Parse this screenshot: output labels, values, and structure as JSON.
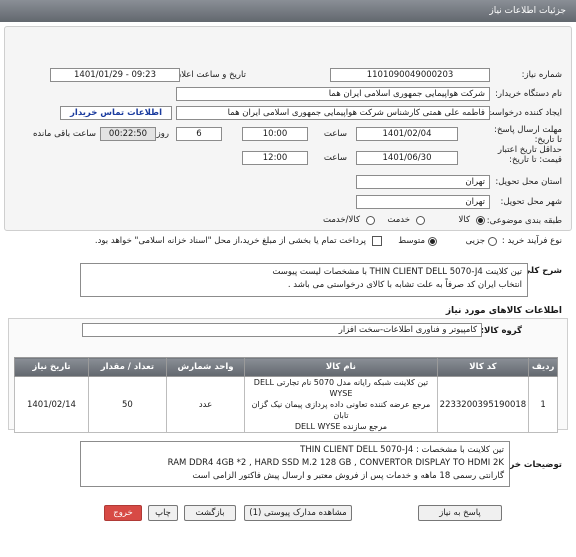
{
  "header": {
    "title": "جزئیات اطلاعات نیاز"
  },
  "form": {
    "need_number_label": "شماره نیاز:",
    "need_number_value": "1101090049000203",
    "announce_label": "تاریخ و ساعت اعلان عمومی:",
    "announce_value": "1401/01/29 - 09:23",
    "buyer_org_label": "نام دستگاه خریدار:",
    "buyer_org_value": "شرکت هواپیمایی جمهوری اسلامی ایران هما",
    "creator_label": "ایجاد کننده درخواست:",
    "creator_value": "فاطمه علی همتی کارشناس شرکت هواپیمایی جمهوری اسلامی ایران هما",
    "contact_button": "اطلاعات تماس خریدار",
    "deadline_label": "مهلت ارسال پاسخ: تا تاریخ:",
    "deadline_date": "1401/02/04",
    "time_label": "ساعت",
    "deadline_time": "10:00",
    "days_count": "6",
    "days_label": "روز و",
    "remaining_time": "00:22:50",
    "remaining_label": "ساعت باقی مانده",
    "validity_label": "حداقل تاریخ اعتبار قیمت: تا تاریخ:",
    "validity_date": "1401/06/30",
    "validity_time_label": "ساعت",
    "validity_time": "12:00",
    "province_label": "استان محل تحویل:",
    "province_value": "تهران",
    "city_label": "شهر محل تحویل:",
    "city_value": "تهران",
    "category_label": "طبقه بندی موضوعی:",
    "category_options": [
      "کالا",
      "خدمت",
      "کالا/خدمت"
    ],
    "category_selected": "کالا",
    "process_label": "نوع فرآیند خرید :",
    "process_options": [
      "جزیی",
      "متوسط"
    ],
    "process_selected": "متوسط",
    "payment_note": "پرداخت تمام یا بخشی از مبلغ خرید،از محل \"اسناد خزانه اسلامی\" خواهد بود."
  },
  "summary": {
    "label": "شرح کلی نیاز:",
    "line1": "تین کلاینت  THIN CLIENT DELL 5070-J4 با مشخصات لیست پیوست",
    "line2": "انتخاب ایران کد صرفاً به علت تشابه با کالای درخواستی می باشد ."
  },
  "goods": {
    "section_title": "اطلاعات کالاهای مورد نیاز",
    "group_label": "گروه کالا:",
    "group_value": "کامپیوتر و فناوری اطلاعات-سخت افزار",
    "table": {
      "headers": [
        "ردیف",
        "کد کالا",
        "نام کالا",
        "واحد شمارش",
        "تعداد / مقدار",
        "تاریخ نیاز"
      ],
      "rows": [
        {
          "row": "1",
          "code": "2233200395190018",
          "name_l1": "تین کلاینت شبکه رایانه مدل 5070 نام تجارتی DELL WYSE",
          "name_l2": "مرجع عرضه کننده تعاونی داده پردازی پیمان نیک گزان تابان",
          "name_l3": "مرجع سازنده DELL WYSE",
          "unit": "عدد",
          "qty": "50",
          "date": "1401/02/14"
        }
      ]
    }
  },
  "buyer_notes": {
    "label": "توضیحات خریدار:",
    "line1": "تین کلاینت با مشخصات : THIN CLIENT DELL 5070-J4",
    "line2": "RAM DDR4 4GB *2 , HARD SSD M.2 128 GB , CONVERTOR DISPLAY TO HDMI 2K",
    "line3": "گارانتی رسمی 18 ماهه و خدمات پس از فروش معتبر و ارسال پیش فاکتور الزامی است"
  },
  "footer": {
    "reply_button": "پاسخ به نیاز",
    "docs_button": "مشاهده مدارک پیوستی (1)",
    "back_button": "بازگشت",
    "print_button": "چاپ",
    "exit_button": "خروج"
  }
}
